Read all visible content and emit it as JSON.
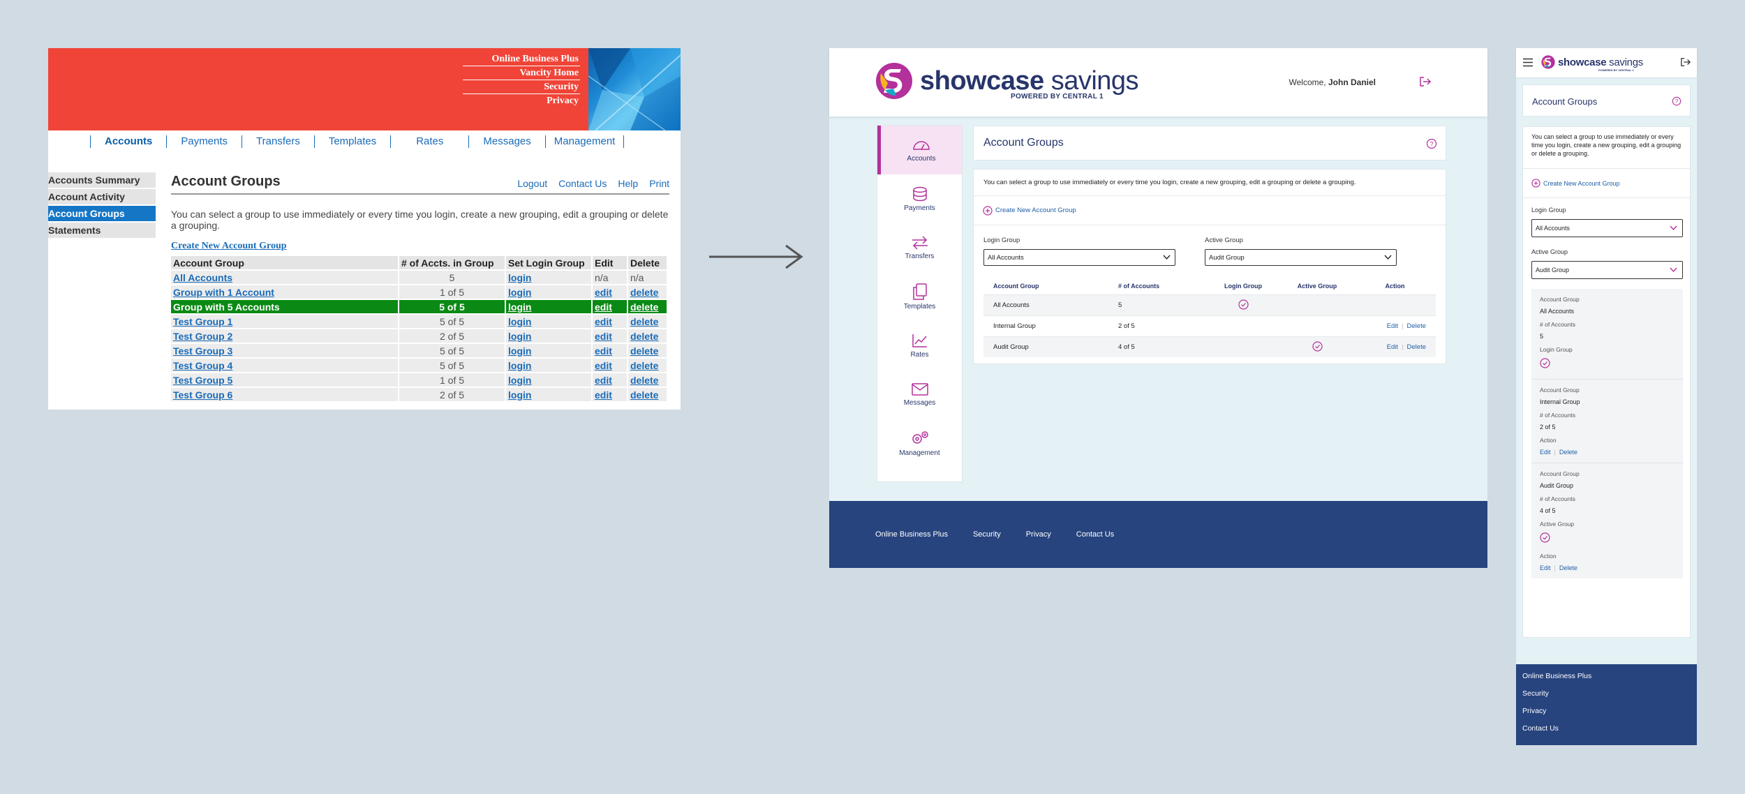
{
  "old_ui": {
    "banner_links": [
      "Online Business Plus",
      "Vancity Home",
      "Security",
      "Privacy"
    ],
    "top_nav": [
      "Accounts",
      "Payments",
      "Transfers",
      "Templates",
      "Rates",
      "Messages",
      "Management"
    ],
    "side_nav": [
      "Accounts Summary",
      "Account Activity",
      "Account Groups",
      "Statements"
    ],
    "title": "Account Groups",
    "header_links": [
      "Logout",
      "Contact Us",
      "Help",
      "Print"
    ],
    "description": "You can select a group to use immediately or every time you login, create a new grouping, edit a grouping or delete a grouping.",
    "create_link": "Create New Account Group",
    "table_headers": [
      "Account Group",
      "# of Accts. in Group",
      "Set Login Group",
      "Edit",
      "Delete"
    ],
    "rows": [
      {
        "name": "All Accounts",
        "count": "5",
        "login": "login",
        "edit": "n/a",
        "delete": "n/a"
      },
      {
        "name": "Group with 1 Account",
        "count": "1 of 5",
        "login": "login",
        "edit": "edit",
        "delete": "delete"
      },
      {
        "name": "Group with 5 Accounts",
        "count": "5 of 5",
        "login": "login",
        "edit": "edit",
        "delete": "delete"
      },
      {
        "name": "Test Group 1",
        "count": "5 of 5",
        "login": "login",
        "edit": "edit",
        "delete": "delete"
      },
      {
        "name": "Test Group 2",
        "count": "2 of 5",
        "login": "login",
        "edit": "edit",
        "delete": "delete"
      },
      {
        "name": "Test Group 3",
        "count": "5 of 5",
        "login": "login",
        "edit": "edit",
        "delete": "delete"
      },
      {
        "name": "Test Group 4",
        "count": "5 of 5",
        "login": "login",
        "edit": "edit",
        "delete": "delete"
      },
      {
        "name": "Test Group 5",
        "count": "1 of 5",
        "login": "login",
        "edit": "edit",
        "delete": "delete"
      },
      {
        "name": "Test Group 6",
        "count": "2 of 5",
        "login": "login",
        "edit": "edit",
        "delete": "delete"
      }
    ]
  },
  "desktop": {
    "brand_bold": "showcase",
    "brand_light": " savings",
    "powered_by": "POWERED BY CENTRAL 1",
    "welcome_prefix": "Welcome, ",
    "user_name": "John Daniel",
    "nav": [
      "Accounts",
      "Payments",
      "Transfers",
      "Templates",
      "Rates",
      "Messages",
      "Management"
    ],
    "page_title": "Account Groups",
    "description": "You can select a group to use immediately or every time you login, create a new grouping, edit a grouping or delete a grouping.",
    "create_link": "Create New Account Group",
    "login_group_label": "Login Group",
    "login_group_value": "All Accounts",
    "active_group_label": "Active Group",
    "active_group_value": "Audit Group",
    "table_headers": [
      "Account Group",
      "# of Accounts",
      "Login Group",
      "Active Group",
      "Action"
    ],
    "rows": [
      {
        "name": "All Accounts",
        "count": "5",
        "login": true,
        "active": false,
        "edit": "",
        "delete": ""
      },
      {
        "name": "Internal Group",
        "count": "2 of 5",
        "login": false,
        "active": false,
        "edit": "Edit",
        "delete": "Delete"
      },
      {
        "name": "Audit Group",
        "count": "4 of 5",
        "login": false,
        "active": true,
        "edit": "Edit",
        "delete": "Delete"
      }
    ],
    "footer_links": [
      "Online Business Plus",
      "Security",
      "Privacy",
      "Contact Us"
    ]
  },
  "mobile": {
    "brand_bold": "showcase",
    "brand_light": " savings",
    "powered_by": "POWERED BY CENTRAL 1",
    "page_title": "Account Groups",
    "description": "You can select a group to use immediately or every time you login, create a new grouping, edit a grouping or delete a grouping.",
    "create_link": "Create New Account Group",
    "login_group_label": "Login Group",
    "login_group_value": "All Accounts",
    "active_group_label": "Active Group",
    "active_group_value": "Audit Group",
    "label_group": "Account Group",
    "label_count": "# of Accounts",
    "label_login": "Login Group",
    "label_active": "Active Group",
    "label_action": "Action",
    "edit": "Edit",
    "delete": "Delete",
    "records": [
      {
        "name": "All Accounts",
        "count": "5"
      },
      {
        "name": "Internal Group",
        "count": "2 of 5"
      },
      {
        "name": "Audit Group",
        "count": "4 of 5"
      }
    ],
    "footer_links": [
      "Online Business Plus",
      "Security",
      "Privacy",
      "Contact Us"
    ]
  },
  "colors": {
    "old_banner": "#f04438",
    "old_highlight": "#0a8a14",
    "brand_navy": "#27356b",
    "brand_magenta": "#b4309b",
    "footer_blue": "#27447f",
    "link_blue": "#1f5fa8"
  }
}
